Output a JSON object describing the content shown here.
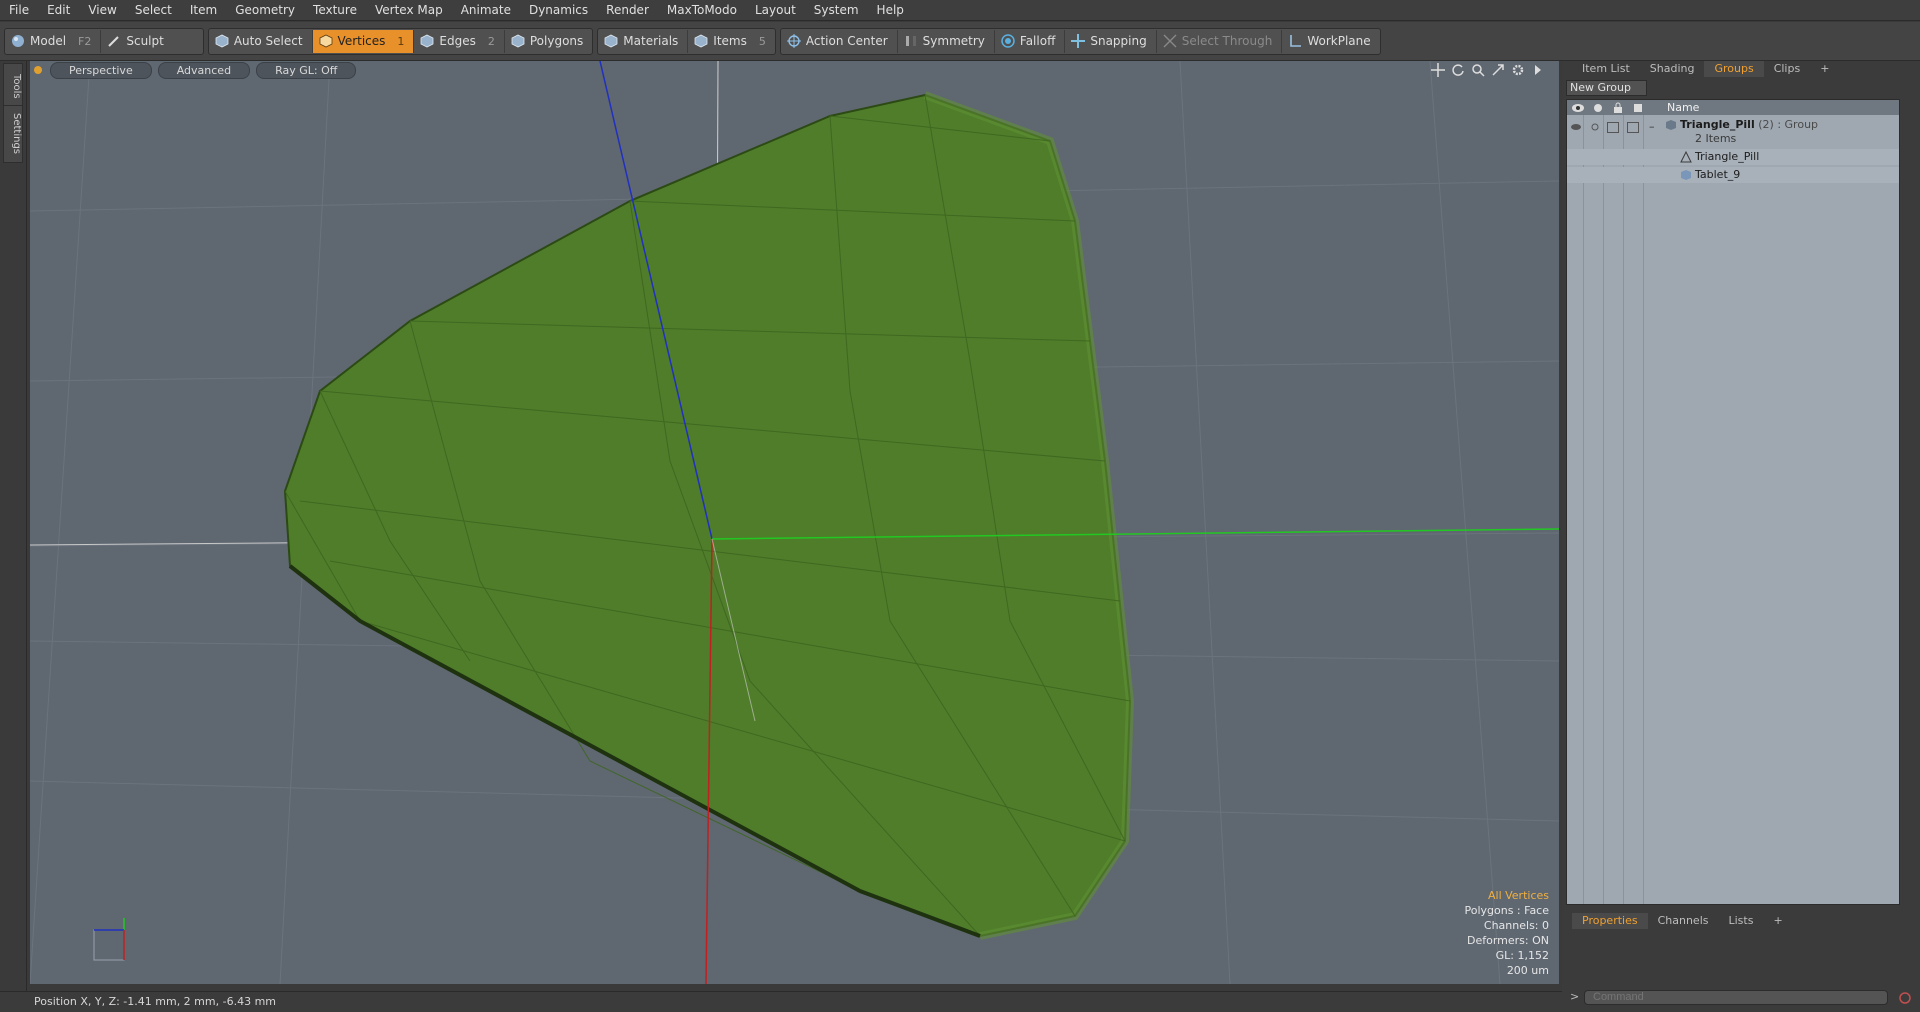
{
  "menubar": [
    "File",
    "Edit",
    "View",
    "Select",
    "Item",
    "Geometry",
    "Texture",
    "Vertex Map",
    "Animate",
    "Dynamics",
    "Render",
    "MaxToModo",
    "Layout",
    "System",
    "Help"
  ],
  "toolbar": {
    "model": "Model",
    "model_key": "F2",
    "sculpt": "Sculpt",
    "auto_select": "Auto Select",
    "vertices": "Vertices",
    "vertices_key": "1",
    "edges": "Edges",
    "edges_key": "2",
    "polygons": "Polygons",
    "materials": "Materials",
    "items": "Items",
    "items_key": "5",
    "action_center": "Action Center",
    "symmetry": "Symmetry",
    "falloff": "Falloff",
    "snapping": "Snapping",
    "select_through": "Select Through",
    "workplane": "WorkPlane"
  },
  "left_tabs": {
    "tools": "Tools",
    "settings": "Settings"
  },
  "viewport": {
    "view": "Perspective",
    "shading": "Advanced",
    "raygl": "Ray GL: Off",
    "info": {
      "selection": "All Vertices",
      "polygons": "Polygons : Face",
      "channels": "Channels: 0",
      "deformers": "Deformers: ON",
      "gl": "GL: 1,152",
      "scale": "200 um"
    },
    "colors": {
      "background": "#5f6771",
      "mesh": "#4f7d2a",
      "x_axis": "#c02020",
      "y_axis": "#22c822",
      "z_axis": "#2030c0"
    }
  },
  "status": {
    "position": "Position X, Y, Z:   -1.41 mm, 2 mm, -6.43 mm"
  },
  "right_panel": {
    "tabs": [
      "Item List",
      "Shading",
      "Groups",
      "Clips"
    ],
    "active_tab": "Groups",
    "new_group": "New Group",
    "column_name": "Name",
    "group": {
      "name": "Triangle_Pill",
      "count": "(2)",
      "type": ": Group",
      "items_label": "2 Items"
    },
    "children": [
      "Triangle_Pill",
      "Tablet_9"
    ],
    "bottom_tabs": [
      "Properties",
      "Channels",
      "Lists"
    ],
    "command_placeholder": "Command"
  }
}
